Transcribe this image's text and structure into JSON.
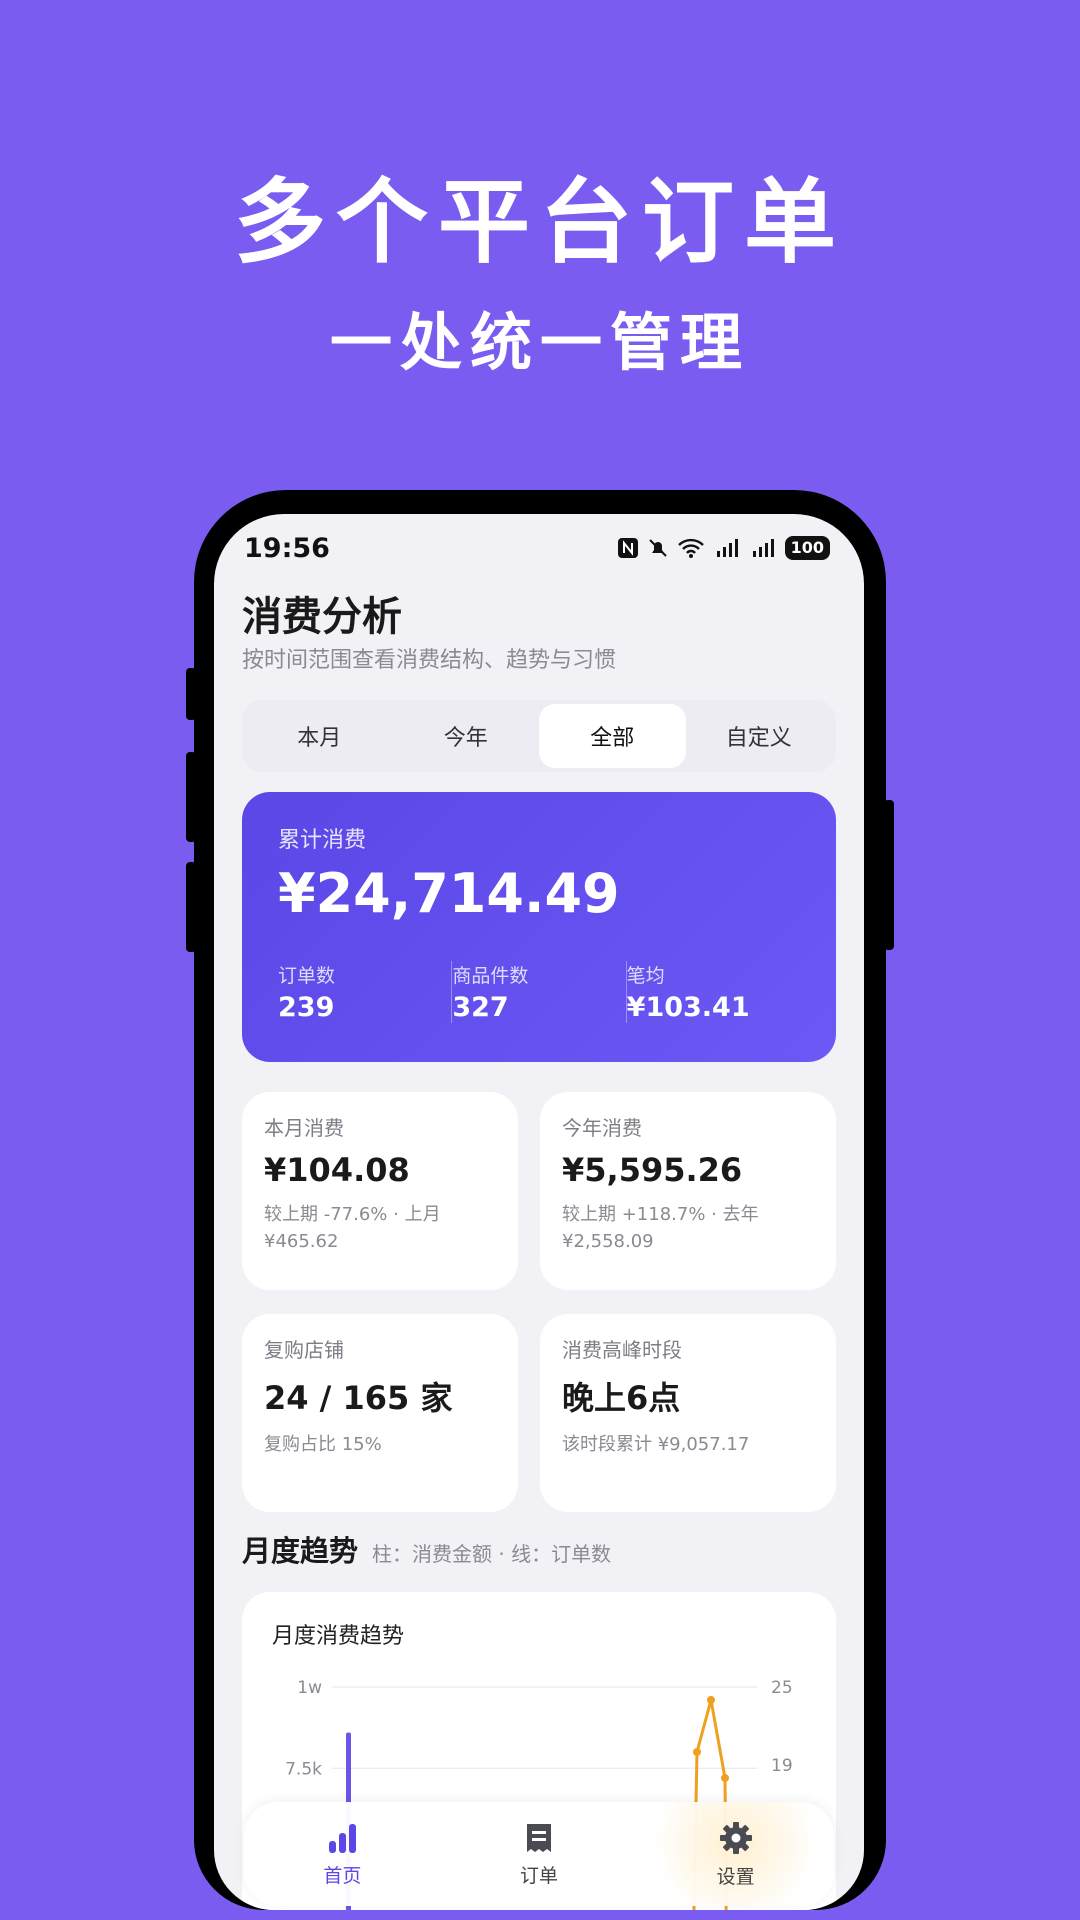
{
  "promo": {
    "title": "多个平台订单",
    "subtitle": "一处统一管理"
  },
  "status_bar": {
    "time": "19:56",
    "battery": "100"
  },
  "header": {
    "title": "消费分析",
    "subtitle": "按时间范围查看消费结构、趋势与习惯"
  },
  "range_tabs": [
    {
      "label": "本月",
      "active": false
    },
    {
      "label": "今年",
      "active": false
    },
    {
      "label": "全部",
      "active": true
    },
    {
      "label": "自定义",
      "active": false
    }
  ],
  "summary": {
    "label": "累计消费",
    "amount": "¥24,714.49",
    "stats": [
      {
        "label": "订单数",
        "value": "239"
      },
      {
        "label": "商品件数",
        "value": "327"
      },
      {
        "label": "笔均",
        "value": "¥103.41"
      }
    ]
  },
  "cards": {
    "month": {
      "label": "本月消费",
      "value": "¥104.08",
      "note": "较上期 -77.6% · 上月 ¥465.62"
    },
    "year": {
      "label": "今年消费",
      "value": "¥5,595.26",
      "note": "较上期 +118.7% · 去年 ¥2,558.09"
    },
    "repeat": {
      "label": "复购店铺",
      "value": "24 / 165 家",
      "note": "复购占比 15%"
    },
    "peak": {
      "label": "消费高峰时段",
      "value": "晚上6点",
      "note": "该时段累计 ¥9,057.17"
    }
  },
  "trend_section": {
    "title": "月度趋势",
    "legend": "柱：消费金额 · 线：订单数"
  },
  "chart_data": {
    "type": "bar",
    "title": "月度消费趋势",
    "left_axis_ticks": [
      "1w",
      "7.5k"
    ],
    "right_axis_ticks": [
      "25",
      "19"
    ],
    "left_ylim": [
      0,
      10000
    ],
    "right_ylim": [
      0,
      25
    ],
    "series": [
      {
        "values": [
          8600
        ]
      },
      {
        "values": [
          20,
          24,
          18
        ]
      }
    ],
    "colors": {
      "bar": "#6a56e8",
      "line": "#f0a020"
    }
  },
  "tabbar": [
    {
      "label": "首页",
      "icon": "bar-chart-icon",
      "active": true
    },
    {
      "label": "订单",
      "icon": "receipt-icon",
      "active": false
    },
    {
      "label": "设置",
      "icon": "gear-icon",
      "active": false
    }
  ]
}
